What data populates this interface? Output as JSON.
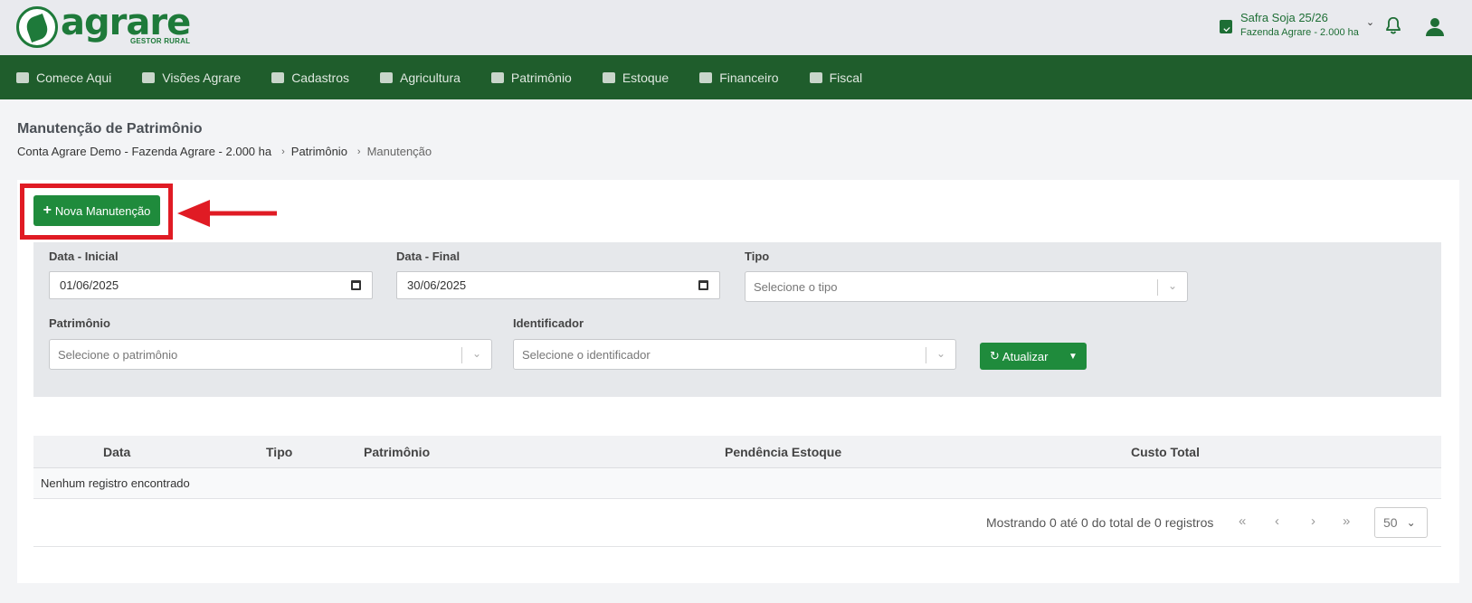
{
  "header": {
    "brand": "agrare",
    "brand_sub": "GESTOR RURAL",
    "safra": "Safra Soja 25/26",
    "fazenda": "Fazenda Agrare - 2.000 ha"
  },
  "nav": [
    {
      "label": "Comece Aqui",
      "icon": "handshake-icon"
    },
    {
      "label": "Visões Agrare",
      "icon": "dashboard-icon"
    },
    {
      "label": "Cadastros",
      "icon": "truck-icon"
    },
    {
      "label": "Agricultura",
      "icon": "leaf-icon"
    },
    {
      "label": "Patrimônio",
      "icon": "tractor-icon"
    },
    {
      "label": "Estoque",
      "icon": "boxes-icon"
    },
    {
      "label": "Financeiro",
      "icon": "hand-money-icon"
    },
    {
      "label": "Fiscal",
      "icon": "invoice-icon"
    }
  ],
  "page": {
    "title": "Manutenção de Patrimônio",
    "breadcrumb": [
      "Conta Agrare Demo - Fazenda Agrare - 2.000 ha",
      "Patrimônio",
      "Manutenção"
    ]
  },
  "actions": {
    "new_label": "Nova Manutenção"
  },
  "filters": {
    "data_inicial_label": "Data - Inicial",
    "data_inicial_value": "01/06/2025",
    "data_final_label": "Data - Final",
    "data_final_value": "30/06/2025",
    "tipo_label": "Tipo",
    "tipo_placeholder": "Selecione o tipo",
    "patrimonio_label": "Patrimônio",
    "patrimonio_placeholder": "Selecione o patrimônio",
    "identificador_label": "Identificador",
    "identificador_placeholder": "Selecione o identificador",
    "update_label": "Atualizar"
  },
  "table": {
    "columns": [
      "Data",
      "Tipo",
      "Patrimônio",
      "Pendência Estoque",
      "Custo Total"
    ],
    "empty_message": "Nenhum registro encontrado",
    "showing": "Mostrando 0 até 0 do total de 0 registros",
    "page_size": "50"
  },
  "colors": {
    "brand_green": "#1e7a3a",
    "nav_bg": "#1f5d2c",
    "button_green": "#1f8b3c",
    "highlight_red": "#e01b24"
  }
}
